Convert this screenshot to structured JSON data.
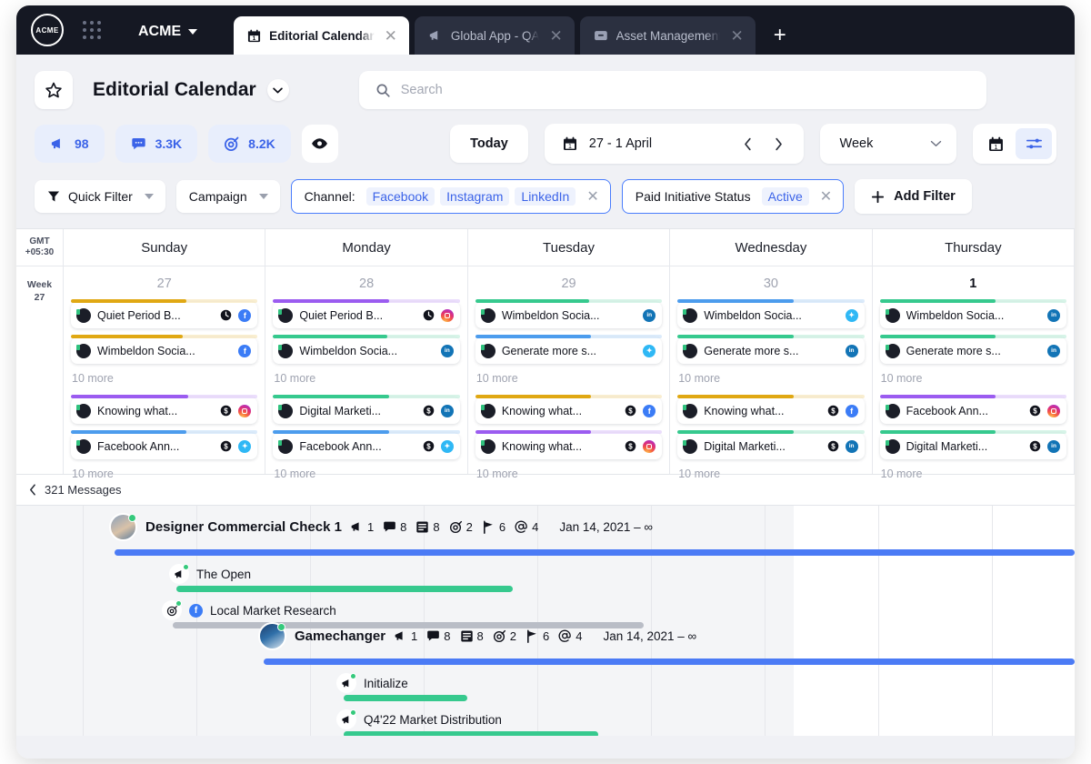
{
  "window": {
    "brand": "ACME",
    "org_name": "ACME",
    "tabs": [
      {
        "label": "Editorial Calendar",
        "icon": "calendar-icon",
        "active": true
      },
      {
        "label": "Global App - QA",
        "icon": "megaphone-icon",
        "active": false
      },
      {
        "label": "Asset Management",
        "icon": "archive-icon",
        "active": false
      }
    ],
    "new_tab_label": "+"
  },
  "header": {
    "title": "Editorial Calendar",
    "star_icon": "star-icon",
    "title_caret_icon": "chevron-down-icon",
    "search": {
      "placeholder": "Search",
      "value": "",
      "icon": "search-icon"
    }
  },
  "toolbar": {
    "stats": [
      {
        "icon": "megaphone-icon",
        "value": "98"
      },
      {
        "icon": "comment-icon",
        "value": "3.3K"
      },
      {
        "icon": "target-icon",
        "value": "8.2K"
      }
    ],
    "eye_icon": "eye-icon",
    "today_label": "Today",
    "date_range": "27 - 1 April",
    "date_icon": "calendar-icon",
    "prev_icon": "chevron-left-icon",
    "next_icon": "chevron-right-icon",
    "period": "Week",
    "period_caret_icon": "chevron-down-icon",
    "view_calendar_icon": "calendar-icon",
    "view_settings_icon": "sliders-icon"
  },
  "filters": {
    "quick_filter_label": "Quick Filter",
    "quick_filter_icon": "funnel-icon",
    "campaign_label": "Campaign",
    "channel": {
      "key": "Channel:",
      "values": [
        "Facebook",
        "Instagram",
        "LinkedIn"
      ],
      "remove_icon": "close-icon"
    },
    "paid_status": {
      "key": "Paid Initiative Status",
      "value": "Active",
      "remove_icon": "close-icon"
    },
    "add_filter_label": "Add Filter",
    "add_filter_icon": "plus-icon",
    "accent": "#4a7dfc"
  },
  "calendar": {
    "timezone_line1": "GMT",
    "timezone_line2": "+05:30",
    "week_line1": "Week",
    "week_line2": "27",
    "days": [
      {
        "name": "Sunday",
        "number": "27",
        "today": false,
        "group1": [
          {
            "title": "Quiet Period B...",
            "color": "#e0a813",
            "fill": 62,
            "icons": [
              "clock-icon"
            ],
            "badge": "facebook"
          },
          {
            "title": "Wimbeldon Socia...",
            "color": "#e0a813",
            "fill": 60,
            "icons": [],
            "badge": "facebook"
          }
        ],
        "more1": "10 more",
        "group2": [
          {
            "title": "Knowing what...",
            "color": "#9b5cf0",
            "fill": 63,
            "icons": [
              "dollar-icon"
            ],
            "badge": "instagram"
          },
          {
            "title": "Facebook Ann...",
            "color": "#4c9ced",
            "fill": 62,
            "icons": [
              "dollar-icon"
            ],
            "badge": "twitter"
          }
        ],
        "more2": "10 more"
      },
      {
        "name": "Monday",
        "number": "28",
        "today": false,
        "group1": [
          {
            "title": "Quiet Period B...",
            "color": "#9b5cf0",
            "fill": 62,
            "icons": [
              "clock-icon"
            ],
            "badge": "instagram"
          },
          {
            "title": "Wimbeldon Socia...",
            "color": "#36c98e",
            "fill": 61,
            "icons": [],
            "badge": "linkedin"
          }
        ],
        "more1": "10 more",
        "group2": [
          {
            "title": "Digital Marketi...",
            "color": "#36c98e",
            "fill": 62,
            "icons": [
              "dollar-icon"
            ],
            "badge": "linkedin"
          },
          {
            "title": "Facebook Ann...",
            "color": "#4c9ced",
            "fill": 62,
            "icons": [
              "dollar-icon"
            ],
            "badge": "twitter"
          }
        ],
        "more2": "10 more"
      },
      {
        "name": "Tuesday",
        "number": "29",
        "today": false,
        "group1": [
          {
            "title": "Wimbeldon Socia...",
            "color": "#36c98e",
            "fill": 61,
            "icons": [],
            "badge": "linkedin"
          },
          {
            "title": "Generate more s...",
            "color": "#4c9ced",
            "fill": 62,
            "icons": [],
            "badge": "twitter"
          }
        ],
        "more1": "10 more",
        "group2": [
          {
            "title": "Knowing what...",
            "color": "#e0a813",
            "fill": 62,
            "icons": [
              "dollar-icon"
            ],
            "badge": "facebook"
          },
          {
            "title": "Knowing what...",
            "color": "#9b5cf0",
            "fill": 62,
            "icons": [
              "dollar-icon"
            ],
            "badge": "instagram"
          }
        ],
        "more2": "10 more"
      },
      {
        "name": "Wednesday",
        "number": "30",
        "today": false,
        "group1": [
          {
            "title": "Wimbeldon Socia...",
            "color": "#4c9ced",
            "fill": 62,
            "icons": [],
            "badge": "twitter"
          },
          {
            "title": "Generate more s...",
            "color": "#36c98e",
            "fill": 62,
            "icons": [],
            "badge": "linkedin"
          }
        ],
        "more1": "10 more",
        "group2": [
          {
            "title": "Knowing what...",
            "color": "#e0a813",
            "fill": 62,
            "icons": [
              "dollar-icon"
            ],
            "badge": "facebook"
          },
          {
            "title": "Digital Marketi...",
            "color": "#36c98e",
            "fill": 62,
            "icons": [
              "dollar-icon"
            ],
            "badge": "linkedin"
          }
        ],
        "more2": "10 more"
      },
      {
        "name": "Thursday",
        "number": "1",
        "today": true,
        "group1": [
          {
            "title": "Wimbeldon Socia...",
            "color": "#36c98e",
            "fill": 62,
            "icons": [],
            "badge": "linkedin"
          },
          {
            "title": "Generate more s...",
            "color": "#36c98e",
            "fill": 62,
            "icons": [],
            "badge": "linkedin"
          }
        ],
        "more1": "10 more",
        "group2": [
          {
            "title": "Facebook Ann...",
            "color": "#9b5cf0",
            "fill": 62,
            "icons": [
              "dollar-icon"
            ],
            "badge": "instagram"
          },
          {
            "title": "Digital Marketi...",
            "color": "#36c98e",
            "fill": 62,
            "icons": [
              "dollar-icon"
            ],
            "badge": "linkedin"
          }
        ],
        "more2": "10 more"
      }
    ]
  },
  "messages": {
    "back_icon": "chevron-left-icon",
    "label": "321 Messages"
  },
  "gantt": {
    "rows": [
      {
        "name": "Designer Commercial Check 1",
        "meta": [
          {
            "icon": "megaphone-icon",
            "value": "1"
          },
          {
            "icon": "comment-icon",
            "value": "8"
          },
          {
            "icon": "list-icon",
            "value": "8"
          },
          {
            "icon": "target-icon",
            "value": "2"
          },
          {
            "icon": "flag-icon",
            "value": "6"
          },
          {
            "icon": "at-icon",
            "value": "4"
          }
        ],
        "dates": "Jan 14, 2021 – ∞",
        "bar_color": "#4b7bf5",
        "children": [
          {
            "name": "The Open",
            "icon": "megaphone-icon",
            "bar_color": "#36c98e",
            "badge": null
          },
          {
            "name": "Local Market Research",
            "icon": "target-icon",
            "bar_color": "#b9bdc6",
            "badge": "facebook"
          }
        ]
      },
      {
        "name": "Gamechanger",
        "meta": [
          {
            "icon": "megaphone-icon",
            "value": "1"
          },
          {
            "icon": "comment-icon",
            "value": "8"
          },
          {
            "icon": "list-icon",
            "value": "8"
          },
          {
            "icon": "target-icon",
            "value": "2"
          },
          {
            "icon": "flag-icon",
            "value": "6"
          },
          {
            "icon": "at-icon",
            "value": "4"
          }
        ],
        "dates": "Jan 14, 2021 – ∞",
        "bar_color": "#4b7bf5",
        "children": [
          {
            "name": "Initialize",
            "icon": "megaphone-icon",
            "bar_color": "#36c98e",
            "badge": null
          },
          {
            "name": "Q4'22 Market Distribution",
            "icon": "megaphone-icon",
            "bar_color": "#36c98e",
            "badge": null
          }
        ]
      }
    ]
  }
}
